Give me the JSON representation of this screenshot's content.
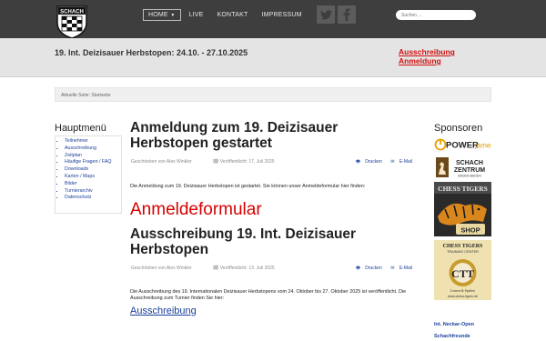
{
  "topbar": {
    "logo_text": "SCHACH",
    "nav": [
      {
        "label": "HOME",
        "active": true,
        "dropdown": true
      },
      {
        "label": "LIVE",
        "active": false
      },
      {
        "label": "KONTAKT",
        "active": false
      },
      {
        "label": "IMPRESSUM",
        "active": false
      }
    ],
    "search_placeholder": "Suchen ...",
    "social": [
      "twitter-icon",
      "facebook-icon"
    ]
  },
  "band": {
    "title": "19. Int. Deizisauer Herbstopen: 24.10. - 27.10.2025",
    "links": [
      "Ausschreibung",
      "Anmeldung"
    ],
    "link_color": "#d21010"
  },
  "breadcrumb": "Aktuelle Seite: Startseite",
  "sidebar": {
    "title": "Hauptmenü",
    "items": [
      "Teilnehmer",
      "Ausschreibung",
      "Zeitplan",
      "Häufige Fragen / FAQ",
      "Downloads",
      "Karten / Maps",
      "Bilder",
      "Turnierarchiv",
      "Datenschutz"
    ]
  },
  "articles": [
    {
      "title": "Anmeldung zum 19. Deizisauer Herbstopen gestartet",
      "author": "Geschrieben von Alex Winkler",
      "date": "Veröffentlicht: 17. Juli 2025",
      "print": "Drucken",
      "email": "E-Mail",
      "text": "Die Anmeldung zum 19. Deizisauer Herbstopen ist gestartet. Sie können unser Anmeldeformular hier finden:",
      "link": "Anmeldeformular"
    },
    {
      "title": "Ausschreibung 19. Int. Deizisauer Herbstopen",
      "author": "Geschrieben von Alex Winkler",
      "date": "Veröffentlicht: 13. Juli 2025",
      "print": "Drucken",
      "email": "E-Mail",
      "text": "Die Ausschreibung des 19. Internationalen Deizisauer Herbstopens vom 24. Oktober bis 27. Oktober 2025 ist veröffentlicht. Die Ausschreibung zum Turnier finden Sie hier:",
      "link": "Ausschreibung"
    }
  ],
  "sponsors": {
    "title": "Sponsoren",
    "powerjames": {
      "a": "POWER",
      "b": "james"
    },
    "schachzentrum": {
      "a": "SCHACH",
      "b": "ZENTRUM",
      "c": "BADEN-BADEN"
    },
    "chesstigers": {
      "a": "CHESS TIGERS",
      "b": "SHOP"
    },
    "training": {
      "a": "CHESS TIGERS",
      "b": "TRAINING CENTER",
      "c": "Lernen & Spielen",
      "d": "www.chess-tigers.de"
    },
    "links": [
      "Int. Neckar-Open",
      "Schachfreunde"
    ]
  },
  "colors": {
    "accent": "#d70000",
    "link": "#1a3f9a",
    "topbar": "#3e3e3e",
    "band": "#e4e4e4"
  }
}
